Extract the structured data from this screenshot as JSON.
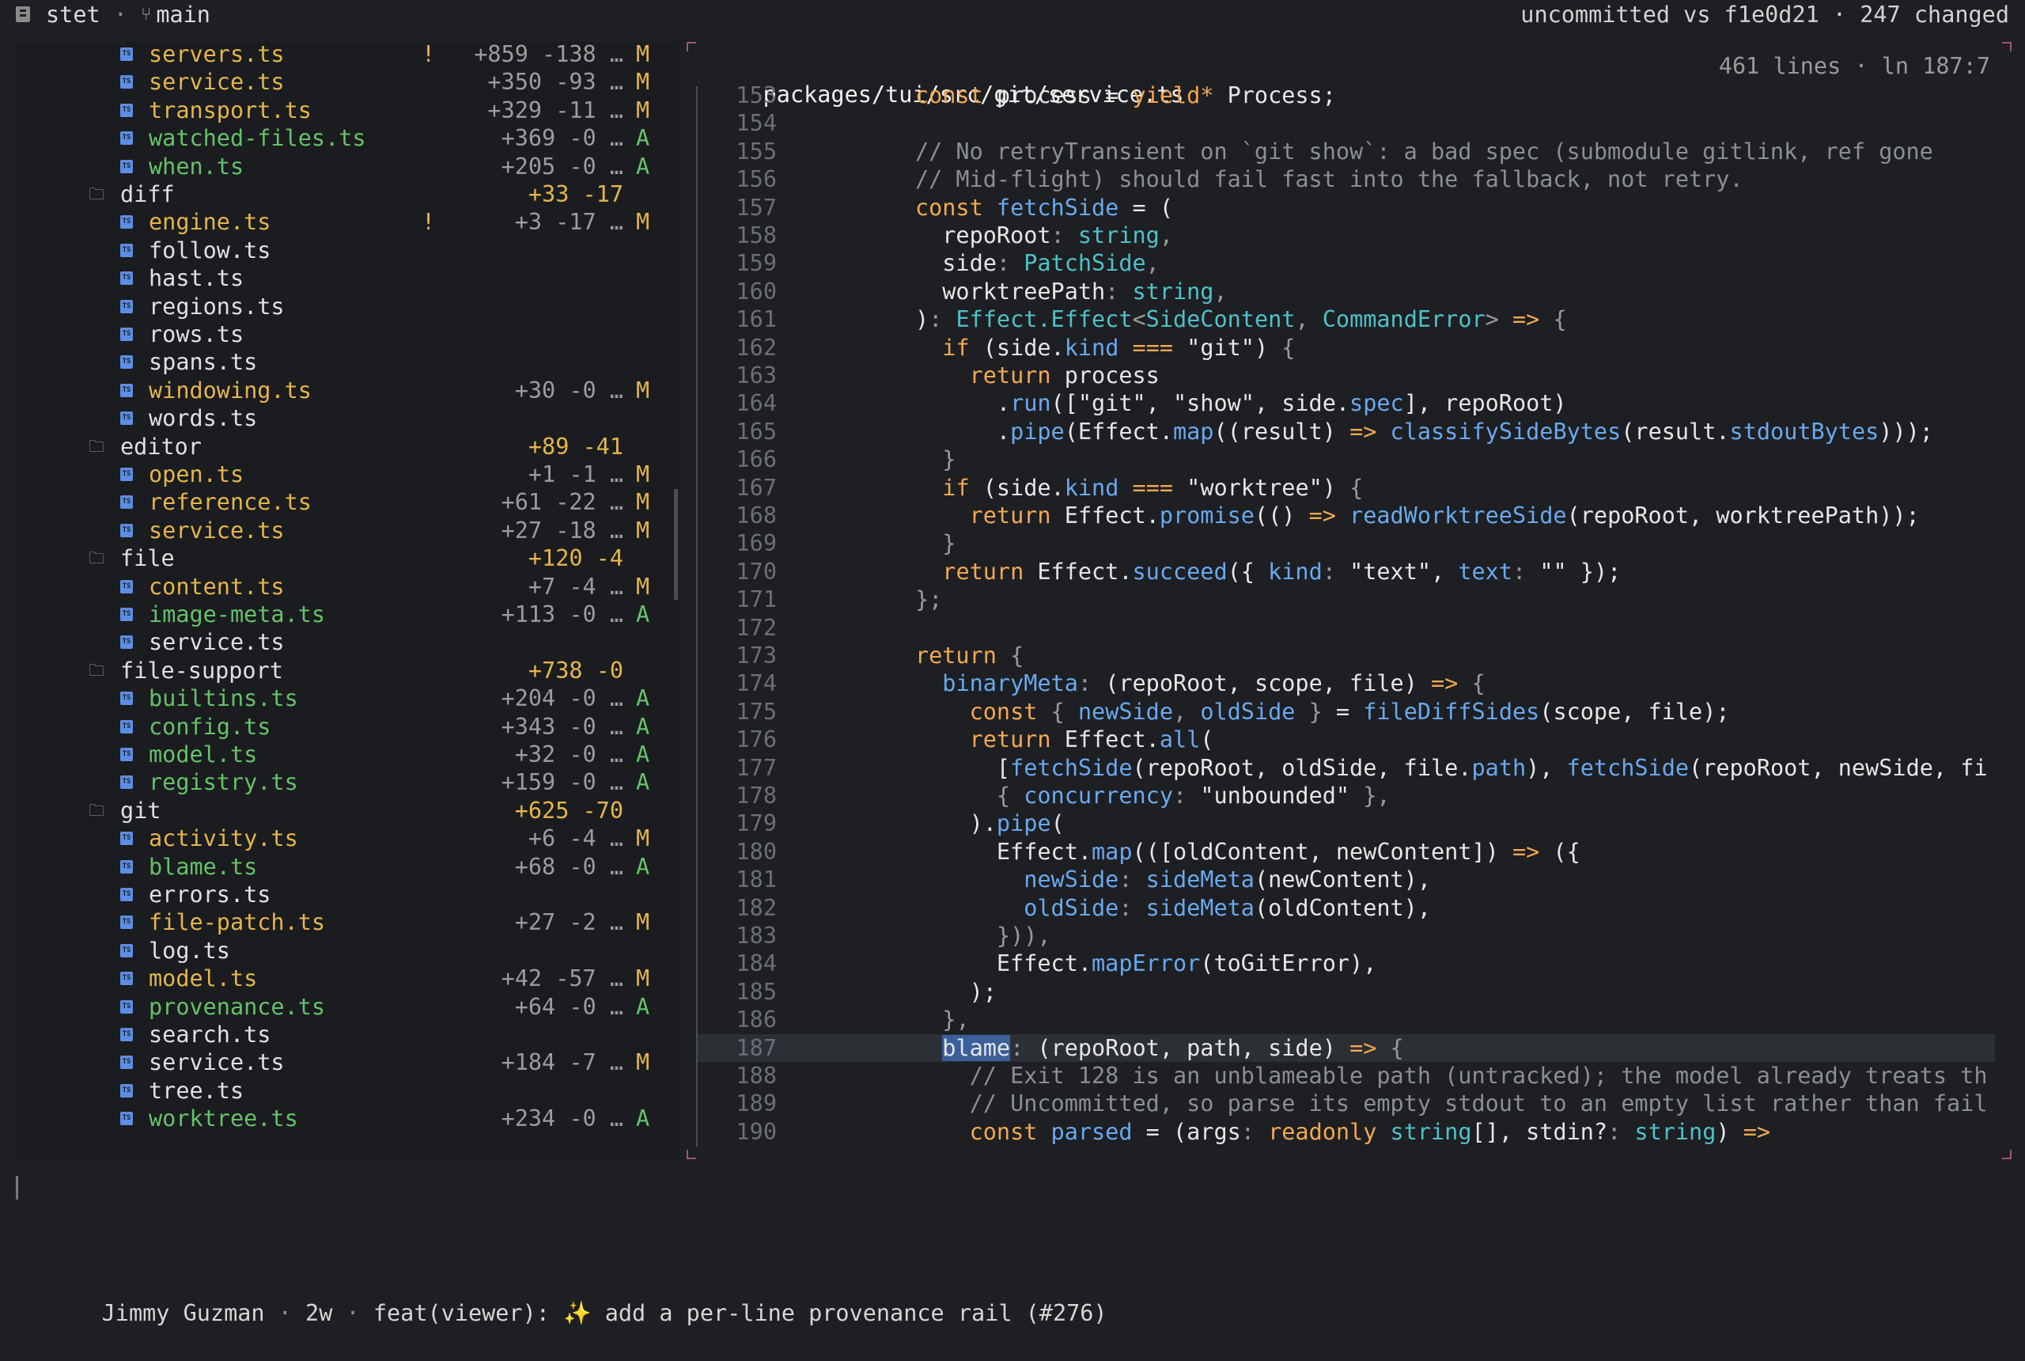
{
  "topbar": {
    "app_name": "stet",
    "separator": "·",
    "branch": "main",
    "compare_info": "uncommitted vs f1e0d21 · 247 changed"
  },
  "file_tree": [
    {
      "type": "file",
      "name": "servers.ts",
      "warn": "!",
      "stat": "+859 -138 …",
      "badge": "M",
      "status": "modified"
    },
    {
      "type": "file",
      "name": "service.ts",
      "stat": "+350 -93 …",
      "badge": "M",
      "status": "modified"
    },
    {
      "type": "file",
      "name": "transport.ts",
      "stat": "+329 -11 …",
      "badge": "M",
      "status": "modified"
    },
    {
      "type": "file",
      "name": "watched-files.ts",
      "stat": "+369 -0 …",
      "badge": "A",
      "status": "added"
    },
    {
      "type": "file",
      "name": "when.ts",
      "stat": "+205 -0 …",
      "badge": "A",
      "status": "added"
    },
    {
      "type": "dir",
      "name": "diff",
      "stat": "+33 -17"
    },
    {
      "type": "file",
      "name": "engine.ts",
      "warn": "!",
      "stat": "+3 -17 …",
      "badge": "M",
      "status": "modified"
    },
    {
      "type": "file",
      "name": "follow.ts",
      "status": "unchanged"
    },
    {
      "type": "file",
      "name": "hast.ts",
      "status": "unchanged"
    },
    {
      "type": "file",
      "name": "regions.ts",
      "status": "unchanged"
    },
    {
      "type": "file",
      "name": "rows.ts",
      "status": "unchanged"
    },
    {
      "type": "file",
      "name": "spans.ts",
      "status": "unchanged"
    },
    {
      "type": "file",
      "name": "windowing.ts",
      "stat": "+30 -0 …",
      "badge": "M",
      "status": "modified"
    },
    {
      "type": "file",
      "name": "words.ts",
      "status": "unchanged"
    },
    {
      "type": "dir",
      "name": "editor",
      "stat": "+89 -41"
    },
    {
      "type": "file",
      "name": "open.ts",
      "stat": "+1 -1 …",
      "badge": "M",
      "status": "modified"
    },
    {
      "type": "file",
      "name": "reference.ts",
      "stat": "+61 -22 …",
      "badge": "M",
      "status": "modified"
    },
    {
      "type": "file",
      "name": "service.ts",
      "stat": "+27 -18 …",
      "badge": "M",
      "status": "modified"
    },
    {
      "type": "dir",
      "name": "file",
      "stat": "+120 -4"
    },
    {
      "type": "file",
      "name": "content.ts",
      "stat": "+7 -4 …",
      "badge": "M",
      "status": "modified"
    },
    {
      "type": "file",
      "name": "image-meta.ts",
      "stat": "+113 -0 …",
      "badge": "A",
      "status": "added"
    },
    {
      "type": "file",
      "name": "service.ts",
      "status": "unchanged"
    },
    {
      "type": "dir",
      "name": "file-support",
      "stat": "+738 -0"
    },
    {
      "type": "file",
      "name": "builtins.ts",
      "stat": "+204 -0 …",
      "badge": "A",
      "status": "added"
    },
    {
      "type": "file",
      "name": "config.ts",
      "stat": "+343 -0 …",
      "badge": "A",
      "status": "added"
    },
    {
      "type": "file",
      "name": "model.ts",
      "stat": "+32 -0 …",
      "badge": "A",
      "status": "added"
    },
    {
      "type": "file",
      "name": "registry.ts",
      "stat": "+159 -0 …",
      "badge": "A",
      "status": "added"
    },
    {
      "type": "dir",
      "name": "git",
      "stat": "+625 -70"
    },
    {
      "type": "file",
      "name": "activity.ts",
      "stat": "+6 -4 …",
      "badge": "M",
      "status": "modified"
    },
    {
      "type": "file",
      "name": "blame.ts",
      "stat": "+68 -0 …",
      "badge": "A",
      "status": "added"
    },
    {
      "type": "file",
      "name": "errors.ts",
      "status": "unchanged"
    },
    {
      "type": "file",
      "name": "file-patch.ts",
      "stat": "+27 -2 …",
      "badge": "M",
      "status": "modified"
    },
    {
      "type": "file",
      "name": "log.ts",
      "status": "unchanged"
    },
    {
      "type": "file",
      "name": "model.ts",
      "stat": "+42 -57 …",
      "badge": "M",
      "status": "modified"
    },
    {
      "type": "file",
      "name": "provenance.ts",
      "stat": "+64 -0 …",
      "badge": "A",
      "status": "added"
    },
    {
      "type": "file",
      "name": "search.ts",
      "status": "unchanged"
    },
    {
      "type": "file",
      "name": "service.ts",
      "stat": "+184 -7 …",
      "badge": "M",
      "status": "selected"
    },
    {
      "type": "file",
      "name": "tree.ts",
      "status": "unchanged"
    },
    {
      "type": "file",
      "name": "worktree.ts",
      "stat": "+234 -0 …",
      "badge": "A",
      "status": "added"
    }
  ],
  "editor": {
    "path": "packages/tui/src/git/service.ts",
    "meta": "461 lines · ln 187:7",
    "current_line": 187,
    "lines": [
      {
        "n": "153",
        "tokens": [
          [
            "",
            "      "
          ],
          [
            "k",
            "const "
          ],
          [
            "",
            "process = "
          ],
          [
            "k",
            "yield* "
          ],
          [
            "",
            "Process;"
          ]
        ]
      },
      {
        "n": "154",
        "tokens": []
      },
      {
        "n": "155",
        "tokens": [
          [
            "",
            "      "
          ],
          [
            "cm",
            "// No retryTransient on `git show`: a bad spec (submodule gitlink, ref gone"
          ]
        ]
      },
      {
        "n": "156",
        "tokens": [
          [
            "",
            "      "
          ],
          [
            "cm",
            "// Mid-flight) should fail fast into the fallback, not retry."
          ]
        ]
      },
      {
        "n": "157",
        "tokens": [
          [
            "",
            "      "
          ],
          [
            "k",
            "const "
          ],
          [
            "fn",
            "fetchSide"
          ],
          [
            "",
            " = ("
          ]
        ]
      },
      {
        "n": "158",
        "tokens": [
          [
            "",
            "        repoRoot"
          ],
          [
            "pn",
            ": "
          ],
          [
            "ty",
            "string"
          ],
          [
            "pn",
            ","
          ]
        ]
      },
      {
        "n": "159",
        "tokens": [
          [
            "",
            "        side"
          ],
          [
            "pn",
            ": "
          ],
          [
            "ty",
            "PatchSide"
          ],
          [
            "pn",
            ","
          ]
        ]
      },
      {
        "n": "160",
        "tokens": [
          [
            "",
            "        worktreePath"
          ],
          [
            "pn",
            ": "
          ],
          [
            "ty",
            "string"
          ],
          [
            "pn",
            ","
          ]
        ]
      },
      {
        "n": "161",
        "tokens": [
          [
            "",
            "      )"
          ],
          [
            "pn",
            ": "
          ],
          [
            "ty",
            "Effect.Effect"
          ],
          [
            "pn",
            "<"
          ],
          [
            "ty",
            "SideContent"
          ],
          [
            "pn",
            ", "
          ],
          [
            "ty",
            "CommandError"
          ],
          [
            "pn",
            "> "
          ],
          [
            "k",
            "=> "
          ],
          [
            "pn",
            "{"
          ]
        ]
      },
      {
        "n": "162",
        "tokens": [
          [
            "",
            "        "
          ],
          [
            "k",
            "if "
          ],
          [
            "",
            "(side."
          ],
          [
            "pr",
            "kind"
          ],
          [
            "",
            " "
          ],
          [
            "k",
            "==="
          ],
          [
            "",
            " \"git\") "
          ],
          [
            "pn",
            "{"
          ]
        ]
      },
      {
        "n": "163",
        "tokens": [
          [
            "",
            "          "
          ],
          [
            "k",
            "return "
          ],
          [
            "",
            "process"
          ]
        ]
      },
      {
        "n": "164",
        "tokens": [
          [
            "",
            "            ."
          ],
          [
            "fn",
            "run"
          ],
          [
            "",
            "([\"git\", \"show\", side."
          ],
          [
            "pr",
            "spec"
          ],
          [
            "",
            "], repoRoot)"
          ]
        ]
      },
      {
        "n": "165",
        "tokens": [
          [
            "",
            "            ."
          ],
          [
            "fn",
            "pipe"
          ],
          [
            "",
            "(Effect."
          ],
          [
            "fn",
            "map"
          ],
          [
            "",
            "((result) "
          ],
          [
            "k",
            "=> "
          ],
          [
            "fn",
            "classifySideBytes"
          ],
          [
            "",
            "(result."
          ],
          [
            "pr",
            "stdoutBytes"
          ],
          [
            "",
            ")));"
          ]
        ]
      },
      {
        "n": "166",
        "tokens": [
          [
            "",
            "        "
          ],
          [
            "pn",
            "}"
          ]
        ]
      },
      {
        "n": "167",
        "tokens": [
          [
            "",
            "        "
          ],
          [
            "k",
            "if "
          ],
          [
            "",
            "(side."
          ],
          [
            "pr",
            "kind"
          ],
          [
            "",
            " "
          ],
          [
            "k",
            "==="
          ],
          [
            "",
            " \"worktree\") "
          ],
          [
            "pn",
            "{"
          ]
        ]
      },
      {
        "n": "168",
        "tokens": [
          [
            "",
            "          "
          ],
          [
            "k",
            "return "
          ],
          [
            "",
            "Effect."
          ],
          [
            "fn",
            "promise"
          ],
          [
            "",
            "(() "
          ],
          [
            "k",
            "=> "
          ],
          [
            "fn",
            "readWorktreeSide"
          ],
          [
            "",
            "(repoRoot, worktreePath));"
          ]
        ]
      },
      {
        "n": "169",
        "tokens": [
          [
            "",
            "        "
          ],
          [
            "pn",
            "}"
          ]
        ]
      },
      {
        "n": "170",
        "tokens": [
          [
            "",
            "        "
          ],
          [
            "k",
            "return "
          ],
          [
            "",
            "Effect."
          ],
          [
            "fn",
            "succeed"
          ],
          [
            "",
            "({ "
          ],
          [
            "pr",
            "kind"
          ],
          [
            "pn",
            ": "
          ],
          [
            "",
            "\"text\", "
          ],
          [
            "pr",
            "text"
          ],
          [
            "pn",
            ": "
          ],
          [
            "",
            "\"\" });"
          ]
        ]
      },
      {
        "n": "171",
        "tokens": [
          [
            "",
            "      "
          ],
          [
            "pn",
            "};"
          ]
        ]
      },
      {
        "n": "172",
        "tokens": []
      },
      {
        "n": "173",
        "tokens": [
          [
            "",
            "      "
          ],
          [
            "k",
            "return "
          ],
          [
            "pn",
            "{"
          ]
        ]
      },
      {
        "n": "174",
        "tokens": [
          [
            "",
            "        "
          ],
          [
            "fn",
            "binaryMeta"
          ],
          [
            "pn",
            ": "
          ],
          [
            "",
            "(repoRoot, scope, file) "
          ],
          [
            "k",
            "=> "
          ],
          [
            "pn",
            "{"
          ]
        ]
      },
      {
        "n": "175",
        "tokens": [
          [
            "",
            "          "
          ],
          [
            "k",
            "const "
          ],
          [
            "pn",
            "{ "
          ],
          [
            "fn",
            "newSide"
          ],
          [
            "pn",
            ", "
          ],
          [
            "fn",
            "oldSide"
          ],
          [
            "pn",
            " } "
          ],
          [
            "",
            "= "
          ],
          [
            "fn",
            "fileDiffSides"
          ],
          [
            "",
            "(scope, file);"
          ]
        ]
      },
      {
        "n": "176",
        "tokens": [
          [
            "",
            "          "
          ],
          [
            "k",
            "return "
          ],
          [
            "",
            "Effect."
          ],
          [
            "fn",
            "all"
          ],
          [
            "",
            "("
          ]
        ]
      },
      {
        "n": "177",
        "tokens": [
          [
            "",
            "            ["
          ],
          [
            "fn",
            "fetchSide"
          ],
          [
            "",
            "(repoRoot, oldSide, file."
          ],
          [
            "pr",
            "path"
          ],
          [
            "",
            "), "
          ],
          [
            "fn",
            "fetchSide"
          ],
          [
            "",
            "(repoRoot, newSide, fi"
          ]
        ]
      },
      {
        "n": "178",
        "tokens": [
          [
            "",
            "            "
          ],
          [
            "pn",
            "{ "
          ],
          [
            "pr",
            "concurrency"
          ],
          [
            "pn",
            ": "
          ],
          [
            "",
            "\"unbounded\" "
          ],
          [
            "pn",
            "},"
          ]
        ]
      },
      {
        "n": "179",
        "tokens": [
          [
            "",
            "          )."
          ],
          [
            "fn",
            "pipe"
          ],
          [
            "",
            "("
          ]
        ]
      },
      {
        "n": "180",
        "tokens": [
          [
            "",
            "            Effect."
          ],
          [
            "fn",
            "map"
          ],
          [
            "",
            "(([oldContent, newContent]) "
          ],
          [
            "k",
            "=> "
          ],
          [
            "",
            "({"
          ]
        ]
      },
      {
        "n": "181",
        "tokens": [
          [
            "",
            "              "
          ],
          [
            "pr",
            "newSide"
          ],
          [
            "pn",
            ": "
          ],
          [
            "fn",
            "sideMeta"
          ],
          [
            "",
            "(newContent),"
          ]
        ]
      },
      {
        "n": "182",
        "tokens": [
          [
            "",
            "              "
          ],
          [
            "pr",
            "oldSide"
          ],
          [
            "pn",
            ": "
          ],
          [
            "fn",
            "sideMeta"
          ],
          [
            "",
            "(oldContent),"
          ]
        ]
      },
      {
        "n": "183",
        "tokens": [
          [
            "",
            "            "
          ],
          [
            "pn",
            "})),"
          ]
        ]
      },
      {
        "n": "184",
        "tokens": [
          [
            "",
            "            Effect."
          ],
          [
            "fn",
            "mapError"
          ],
          [
            "",
            "(toGitError),"
          ]
        ]
      },
      {
        "n": "185",
        "tokens": [
          [
            "",
            "          );"
          ]
        ]
      },
      {
        "n": "186",
        "tokens": [
          [
            "",
            "        "
          ],
          [
            "pn",
            "},"
          ]
        ]
      },
      {
        "n": "187",
        "tokens": [
          [
            "",
            "        "
          ],
          [
            "sel",
            "blame"
          ],
          [
            "pn",
            ": "
          ],
          [
            "",
            "(repoRoot, path, side) "
          ],
          [
            "k",
            "=> "
          ],
          [
            "pn",
            "{"
          ]
        ]
      },
      {
        "n": "188",
        "tokens": [
          [
            "",
            "          "
          ],
          [
            "cm",
            "// Exit 128 is an unblameable path (untracked); the model already treats th"
          ]
        ]
      },
      {
        "n": "189",
        "tokens": [
          [
            "",
            "          "
          ],
          [
            "cm",
            "// Uncommitted, so parse its empty stdout to an empty list rather than fail"
          ]
        ]
      },
      {
        "n": "190",
        "tokens": [
          [
            "",
            "          "
          ],
          [
            "k",
            "const "
          ],
          [
            "fn",
            "parsed"
          ],
          [
            "",
            " = (args"
          ],
          [
            "pn",
            ": "
          ],
          [
            "k",
            "readonly "
          ],
          [
            "ty",
            "string"
          ],
          [
            "",
            "[], stdin?"
          ],
          [
            "pn",
            ": "
          ],
          [
            "ty",
            "string"
          ],
          [
            "",
            ") "
          ],
          [
            "k",
            "=>"
          ]
        ]
      }
    ]
  },
  "statusbar": {
    "author": "Jimmy Guzman",
    "age": "2w",
    "message_prefix": "feat(viewer): ",
    "sparkle": "✨",
    "message": " add a per-line provenance rail (#276)"
  },
  "colors": {
    "modified": "#e5b54a",
    "added": "#65c267",
    "keyword": "#f3a850",
    "type": "#4fc1c9",
    "function": "#69a9ee"
  }
}
